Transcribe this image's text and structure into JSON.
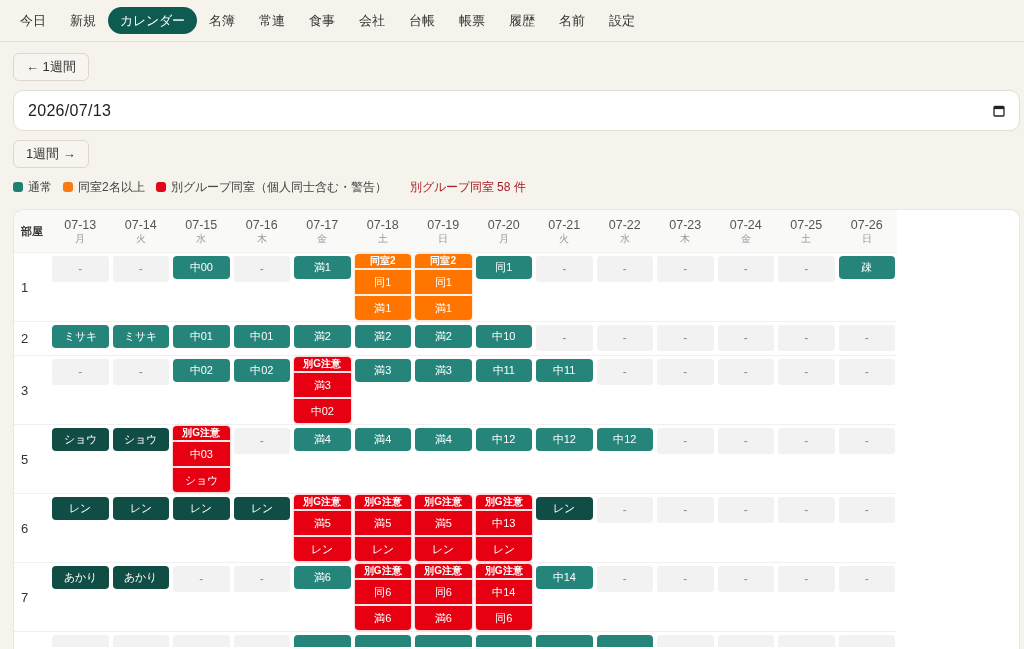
{
  "nav": {
    "tabs": [
      {
        "label": "今日",
        "selected": false
      },
      {
        "label": "新規",
        "selected": false
      },
      {
        "label": "カレンダー",
        "selected": true
      },
      {
        "label": "名簿",
        "selected": false
      },
      {
        "label": "常連",
        "selected": false
      },
      {
        "label": "食事",
        "selected": false
      },
      {
        "label": "会社",
        "selected": false
      },
      {
        "label": "台帳",
        "selected": false
      },
      {
        "label": "帳票",
        "selected": false
      },
      {
        "label": "履歴",
        "selected": false
      },
      {
        "label": "名前",
        "selected": false
      },
      {
        "label": "設定",
        "selected": false
      }
    ]
  },
  "week_nav": {
    "prev": "← 1週間",
    "date": "2026/07/13",
    "next": "1週間 →"
  },
  "legend": {
    "items": [
      {
        "label": "通常",
        "color": "#21806f"
      },
      {
        "label": "同室2名以上",
        "color": "#f97a12"
      },
      {
        "label": "別グループ同室（個人同士含む・警告）",
        "color": "#e0071a"
      }
    ],
    "conflict_count": "別グループ同室 58 件"
  },
  "calendar": {
    "room_header": "部屋",
    "days": [
      {
        "date": "07-13",
        "weekday": "月"
      },
      {
        "date": "07-14",
        "weekday": "火"
      },
      {
        "date": "07-15",
        "weekday": "水"
      },
      {
        "date": "07-16",
        "weekday": "木"
      },
      {
        "date": "07-17",
        "weekday": "金"
      },
      {
        "date": "07-18",
        "weekday": "土"
      },
      {
        "date": "07-19",
        "weekday": "日"
      },
      {
        "date": "07-20",
        "weekday": "月"
      },
      {
        "date": "07-21",
        "weekday": "火"
      },
      {
        "date": "07-22",
        "weekday": "水"
      },
      {
        "date": "07-23",
        "weekday": "木"
      },
      {
        "date": "07-24",
        "weekday": "金"
      },
      {
        "date": "07-25",
        "weekday": "土"
      },
      {
        "date": "07-26",
        "weekday": "日"
      }
    ],
    "rooms": [
      {
        "room": "1",
        "cells": [
          {
            "kind": "empty",
            "label": "-"
          },
          {
            "kind": "empty",
            "label": "-"
          },
          {
            "kind": "normal",
            "label": "中00"
          },
          {
            "kind": "empty",
            "label": "-"
          },
          {
            "kind": "normal",
            "label": "満1"
          },
          {
            "kind": "shared",
            "header": "同室2",
            "entries": [
              "同1",
              "満1"
            ]
          },
          {
            "kind": "shared",
            "header": "同室2",
            "entries": [
              "同1",
              "満1"
            ]
          },
          {
            "kind": "normal",
            "label": "同1"
          },
          {
            "kind": "empty",
            "label": "-"
          },
          {
            "kind": "empty",
            "label": "-"
          },
          {
            "kind": "empty",
            "label": "-"
          },
          {
            "kind": "empty",
            "label": "-"
          },
          {
            "kind": "empty",
            "label": "-"
          },
          {
            "kind": "normal",
            "label": "疎"
          }
        ]
      },
      {
        "room": "2",
        "cells": [
          {
            "kind": "normal",
            "label": "ミサキ"
          },
          {
            "kind": "normal",
            "label": "ミサキ"
          },
          {
            "kind": "normal",
            "label": "中01"
          },
          {
            "kind": "normal",
            "label": "中01"
          },
          {
            "kind": "normal",
            "label": "満2"
          },
          {
            "kind": "normal",
            "label": "満2"
          },
          {
            "kind": "normal",
            "label": "満2"
          },
          {
            "kind": "normal",
            "label": "中10"
          },
          {
            "kind": "empty",
            "label": "-"
          },
          {
            "kind": "empty",
            "label": "-"
          },
          {
            "kind": "empty",
            "label": "-"
          },
          {
            "kind": "empty",
            "label": "-"
          },
          {
            "kind": "empty",
            "label": "-"
          },
          {
            "kind": "empty",
            "label": "-"
          }
        ]
      },
      {
        "room": "3",
        "cells": [
          {
            "kind": "empty",
            "label": "-"
          },
          {
            "kind": "empty",
            "label": "-"
          },
          {
            "kind": "normal",
            "label": "中02"
          },
          {
            "kind": "normal",
            "label": "中02"
          },
          {
            "kind": "warning",
            "header": "別G注意",
            "entries": [
              "満3",
              "中02"
            ]
          },
          {
            "kind": "normal",
            "label": "満3"
          },
          {
            "kind": "normal",
            "label": "満3"
          },
          {
            "kind": "normal",
            "label": "中11"
          },
          {
            "kind": "normal",
            "label": "中11"
          },
          {
            "kind": "empty",
            "label": "-"
          },
          {
            "kind": "empty",
            "label": "-"
          },
          {
            "kind": "empty",
            "label": "-"
          },
          {
            "kind": "empty",
            "label": "-"
          },
          {
            "kind": "empty",
            "label": "-"
          }
        ]
      },
      {
        "room": "5",
        "cells": [
          {
            "kind": "individual",
            "label": "ショウ"
          },
          {
            "kind": "individual",
            "label": "ショウ"
          },
          {
            "kind": "warning",
            "header": "別G注意",
            "entries": [
              "中03",
              "ショウ"
            ]
          },
          {
            "kind": "empty",
            "label": "-"
          },
          {
            "kind": "normal",
            "label": "満4"
          },
          {
            "kind": "normal",
            "label": "満4"
          },
          {
            "kind": "normal",
            "label": "満4"
          },
          {
            "kind": "normal",
            "label": "中12"
          },
          {
            "kind": "normal",
            "label": "中12"
          },
          {
            "kind": "normal",
            "label": "中12"
          },
          {
            "kind": "empty",
            "label": "-"
          },
          {
            "kind": "empty",
            "label": "-"
          },
          {
            "kind": "empty",
            "label": "-"
          },
          {
            "kind": "empty",
            "label": "-"
          }
        ]
      },
      {
        "room": "6",
        "cells": [
          {
            "kind": "individual",
            "label": "レン"
          },
          {
            "kind": "individual",
            "label": "レン"
          },
          {
            "kind": "individual",
            "label": "レン"
          },
          {
            "kind": "individual",
            "label": "レン"
          },
          {
            "kind": "warning",
            "header": "別G注意",
            "entries": [
              "満5",
              "レン"
            ]
          },
          {
            "kind": "warning",
            "header": "別G注意",
            "entries": [
              "満5",
              "レン"
            ]
          },
          {
            "kind": "warning",
            "header": "別G注意",
            "entries": [
              "満5",
              "レン"
            ]
          },
          {
            "kind": "warning",
            "header": "別G注意",
            "entries": [
              "中13",
              "レン"
            ]
          },
          {
            "kind": "individual",
            "label": "レン"
          },
          {
            "kind": "empty",
            "label": "-"
          },
          {
            "kind": "empty",
            "label": "-"
          },
          {
            "kind": "empty",
            "label": "-"
          },
          {
            "kind": "empty",
            "label": "-"
          },
          {
            "kind": "empty",
            "label": "-"
          }
        ]
      },
      {
        "room": "7",
        "cells": [
          {
            "kind": "individual",
            "label": "あかり"
          },
          {
            "kind": "individual",
            "label": "あかり"
          },
          {
            "kind": "empty",
            "label": "-"
          },
          {
            "kind": "empty",
            "label": "-"
          },
          {
            "kind": "normal",
            "label": "満6"
          },
          {
            "kind": "warning",
            "header": "別G注意",
            "entries": [
              "同6",
              "満6"
            ]
          },
          {
            "kind": "warning",
            "header": "別G注意",
            "entries": [
              "同6",
              "満6"
            ]
          },
          {
            "kind": "warning",
            "header": "別G注意",
            "entries": [
              "中14",
              "同6"
            ]
          },
          {
            "kind": "normal",
            "label": "中14"
          },
          {
            "kind": "empty",
            "label": "-"
          },
          {
            "kind": "empty",
            "label": "-"
          },
          {
            "kind": "empty",
            "label": "-"
          },
          {
            "kind": "empty",
            "label": "-"
          },
          {
            "kind": "empty",
            "label": "-"
          }
        ]
      },
      {
        "cells": [
          {
            "kind": "empty"
          },
          {
            "kind": "empty"
          },
          {
            "kind": "empty"
          },
          {
            "kind": "empty"
          },
          {
            "kind": "normal"
          },
          {
            "kind": "normal"
          },
          {
            "kind": "normal"
          },
          {
            "kind": "normal"
          },
          {
            "kind": "normal"
          },
          {
            "kind": "normal"
          },
          {
            "kind": "empty"
          },
          {
            "kind": "empty"
          },
          {
            "kind": "empty"
          },
          {
            "kind": "empty"
          }
        ]
      }
    ]
  }
}
